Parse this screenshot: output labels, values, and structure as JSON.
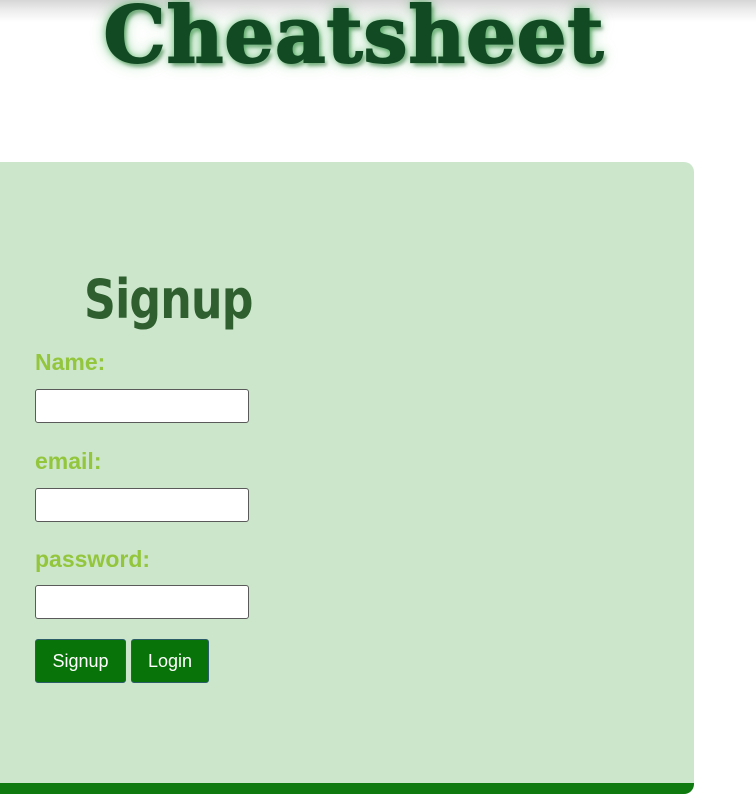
{
  "header": {
    "site_title": "Cheatsheet"
  },
  "signup_form": {
    "heading": "Signup",
    "name_label": "Name:",
    "name_value": "",
    "email_label": "email:",
    "email_value": "",
    "password_label": "password:",
    "password_value": "",
    "signup_button": "Signup",
    "login_button": "Login"
  },
  "colors": {
    "title": "#124a24",
    "card_background": "#cce6cc",
    "card_bottom_border": "#0e7a10",
    "heading": "#2f5f2f",
    "label": "#93c63c",
    "button_background": "#087308",
    "button_text": "#ffffff"
  }
}
